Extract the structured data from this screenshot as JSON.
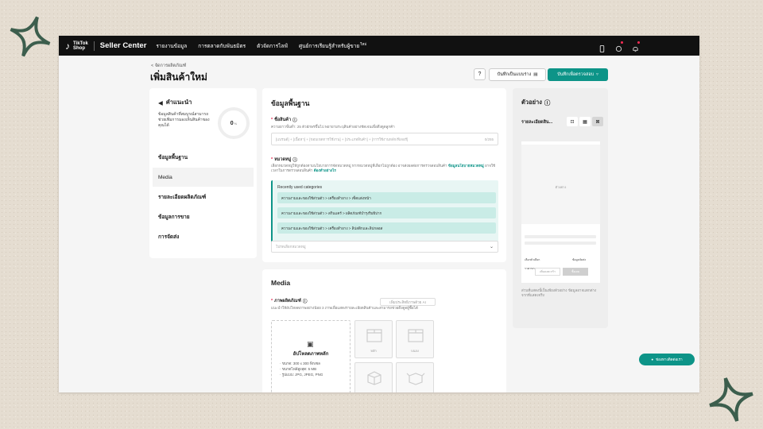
{
  "topbar": {
    "logo_line1": "TikTok",
    "logo_line2": "Shop",
    "brand": "Seller Center",
    "nav": [
      "รายงานข้อมูล",
      "การตลาดกับพันธมิตร",
      "ตัวจัดการไลฟ์",
      "ศูนย์การเรียนรู้สำหรับผู้ขาย"
    ],
    "new_badge": "ใหม่"
  },
  "breadcrumb": "< จัดการผลิตภัณฑ์",
  "page_title": "เพิ่มสินค้าใหม่",
  "actions": {
    "help": "?",
    "save_draft": "บันทึกเป็นแบบร่าง",
    "submit": "บันทึกเพื่อตรวจสอบ"
  },
  "guide": {
    "title": "คำแนะนำ",
    "description": "ข้อมูลสินค้าที่สมบูรณ์สามารถช่วยเพิ่มการมองเห็นสินค้าของคุณได้",
    "progress_value": "0",
    "progress_unit": "%",
    "items": [
      "ข้อมูลพื้นฐาน",
      "Media",
      "รายละเอียดผลิตภัณฑ์",
      "ข้อมูลการขาย",
      "การจัดส่ง"
    ],
    "active_index": 1
  },
  "basic": {
    "title": "ข้อมูลพื้นฐาน",
    "name_label": "ชื่อสินค้า",
    "name_hint": "ความยาวขั้นต่ำ: 25 ตัวอักษรขึ้นไป พยายามระบุสินค้าอย่างชัดเจนเพื่อดึงดูดลูกค้า",
    "name_placeholder": "[แบรนด์] + [เนื้อหา] + [ขอบเขตการใช้งาน] + [ประเภทสินค้า] + [การใช้งานหลัก/ฟีเจอร์]",
    "name_count": "0/255",
    "category_label": "หมวดหมู่",
    "category_hint": "เลือกหมวดหมู่ให้ถูกต้องตามนโยบายการจัดหมวดหมู่ หากหมวดหมู่ที่เลือกไม่ถูกต้อง อาจส่งผลต่อการตรวจสอบสินค้า",
    "category_link": "ข้อมูลนโยบายหมวดหมู่",
    "category_hint2": "อาจใช้เวลาในการตรวจสอบสินค้า",
    "category_link2": "ต้องทำอย่างไร",
    "recent_title": "Recently used categories",
    "recent": [
      "ความงามและของใช้ส่วนตัว > เครื่องสำอาง > เซ็ตแต่งหน้า",
      "ความงามและของใช้ส่วนตัว > สกินแคร์ > ผลิตภัณฑ์บำรุงริมฝีปาก",
      "ความงามและของใช้ส่วนตัว > เครื่องสำอาง > ลิปสติกและลิปกลอส"
    ],
    "category_placeholder": "โปรดเลือกหมวดหมู่"
  },
  "media": {
    "title": "Media",
    "images_label": "ภาพผลิตภัณฑ์",
    "ai_button": "เพิ่มประสิทธิภาพด้วย AI",
    "images_hint": "แนะนำให้อัปโหลดภาพอย่างน้อย 3 ภาพเพื่อแสดงรายละเอียดสินค้าและสามารถช่วยดึงดูดผู้ซื้อได้",
    "upload_title": "อัปโหลดภาพหลัก",
    "specs": [
      "ขนาด: 300 x 300 พิกเซล",
      "ขนาดไฟล์สูงสุด: 5 MB",
      "รูปแบบ: JPG, JPEG, PNG"
    ],
    "thumbs": [
      "หลัก",
      "บนลง",
      "",
      ""
    ]
  },
  "preview": {
    "title": "ตัวอย่าง",
    "subtitle": "รายละเอียดสิน...",
    "image_label": "ตัวอย่าง",
    "row1_left": "เลือกตัวเลือก",
    "row1_right": "ข้อมูลจัดส่ง",
    "row2_left": "ราคาขาย",
    "btn1": "เพิ่มลงตะกร้า",
    "btn2": "ซื้อเลย",
    "note": "ส่วนที่แสดงนี้เป็นเพียงตัวอย่าง ข้อมูลอาจแตกต่างจากที่แสดงจริง"
  },
  "chat": {
    "label": "ช่องทางติดต่อเรา"
  },
  "colors": {
    "accent": "#0d9488",
    "topbar": "#111111",
    "sparkle": "#3c5e4d"
  }
}
